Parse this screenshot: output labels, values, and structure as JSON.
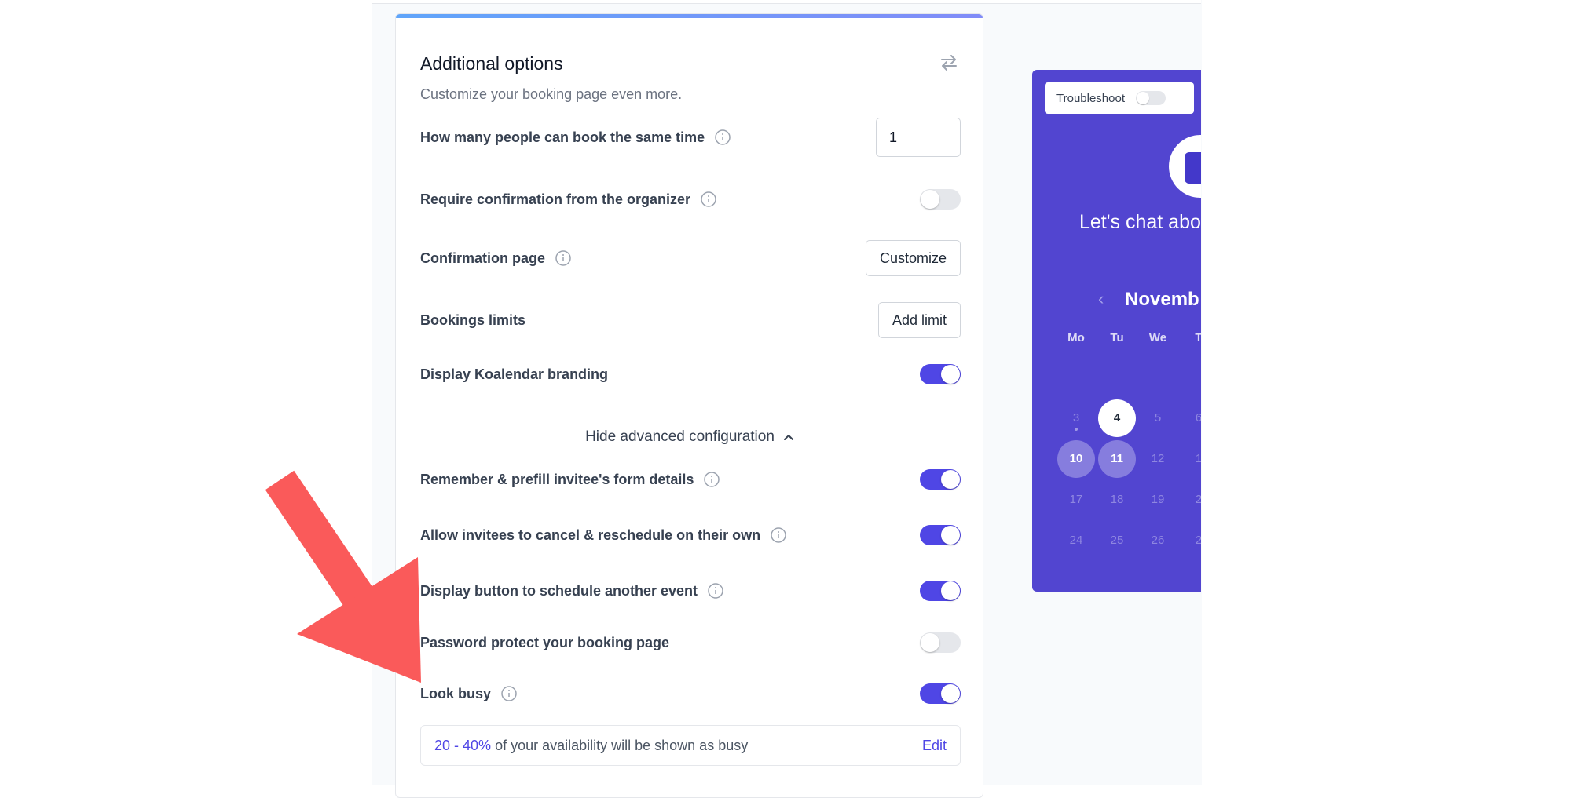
{
  "card": {
    "title": "Additional options",
    "subtitle": "Customize your booking page even more.",
    "swap_icon": "swap-arrows-icon"
  },
  "options": {
    "capacity": {
      "label": "How many people can book the same time",
      "value": "1"
    },
    "require_confirmation": {
      "label": "Require confirmation from the organizer",
      "enabled": false
    },
    "confirmation_page": {
      "label": "Confirmation page",
      "button": "Customize"
    },
    "booking_limits": {
      "label": "Bookings limits",
      "button": "Add limit"
    },
    "branding": {
      "label": "Display Koalendar branding",
      "enabled": true
    },
    "advanced_toggle": "Hide advanced configuration",
    "remember_prefill": {
      "label": "Remember & prefill invitee's form details",
      "enabled": true
    },
    "cancel_reschedule": {
      "label": "Allow invitees to cancel & reschedule on their own",
      "enabled": true
    },
    "schedule_another": {
      "label": "Display button to schedule another event",
      "enabled": true
    },
    "password_protect": {
      "label": "Password protect your booking page",
      "enabled": false
    },
    "look_busy": {
      "label": "Look busy",
      "enabled": true
    }
  },
  "busy_info": {
    "range": "20 - 40%",
    "text": "of your availability will be shown as busy",
    "edit": "Edit"
  },
  "preview": {
    "troubleshoot_label": "Troubleshoot",
    "chat_title": "Let's chat abo",
    "month_label": "Novemb",
    "prev_icon": "chevron-left-icon",
    "weekdays": [
      "Mo",
      "Tu",
      "We",
      "T"
    ],
    "days_row1": [
      "3",
      "4",
      "5",
      "6"
    ],
    "days_row2": [
      "10",
      "11",
      "12",
      "1"
    ],
    "days_row3": [
      "17",
      "18",
      "19",
      "2"
    ],
    "days_row4": [
      "24",
      "25",
      "26",
      "2"
    ]
  },
  "colors": {
    "accent": "#4f46e5",
    "preview_bg": "#5245d0",
    "annotation_arrow": "#fa5a5a"
  }
}
